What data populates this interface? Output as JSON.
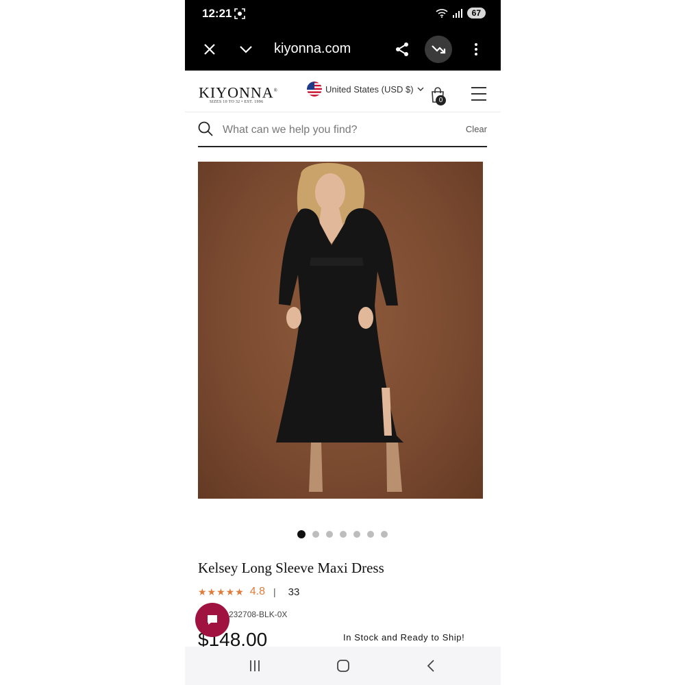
{
  "status": {
    "time": "12:21",
    "battery": "67"
  },
  "browser": {
    "url": "kiyonna.com"
  },
  "site": {
    "logo": "KIYONNA",
    "logo_mark": "®",
    "tagline": "SIZES 10 TO 32  •  EST. 1996",
    "country": "United States (USD $)",
    "cart_count": "0"
  },
  "search": {
    "placeholder": "What can we help you find?",
    "clear": "Clear"
  },
  "gallery": {
    "total_images": 7,
    "current_index": 1
  },
  "product": {
    "title": "Kelsey Long Sleeve Maxi Dress",
    "stars": "★★★★★",
    "rating": "4.8",
    "separator": "|",
    "review_count": "33",
    "sku": "232708-BLK-0X",
    "price": "$148.00",
    "stock": "In Stock and Ready to Ship!"
  },
  "colors": {
    "accent_orange": "#e07b39",
    "chat_bg": "#a0123f",
    "backdrop": "#7a4a30"
  }
}
